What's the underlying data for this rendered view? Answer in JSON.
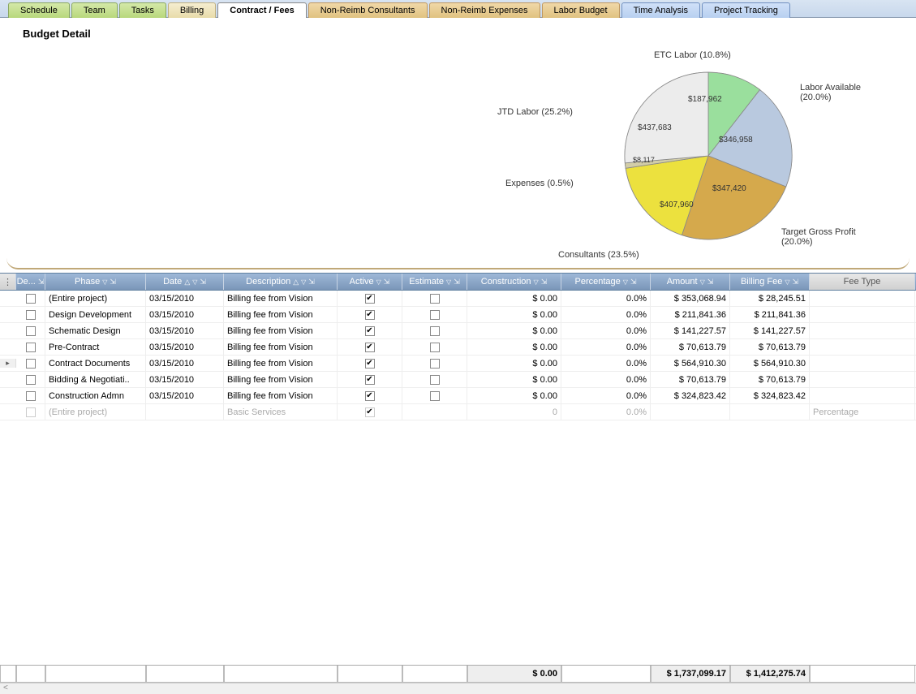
{
  "tabs": {
    "schedule": "Schedule",
    "team": "Team",
    "tasks": "Tasks",
    "billing": "Billing",
    "contract": "Contract / Fees",
    "nrc": "Non-Reimb Consultants",
    "nre": "Non-Reimb Expenses",
    "labor": "Labor Budget",
    "time": "Time Analysis",
    "ptrack": "Project Tracking"
  },
  "panel": {
    "title": "Budget Detail"
  },
  "chart_data": {
    "type": "pie",
    "title": "Budget Detail",
    "series": [
      {
        "name": "ETC Labor",
        "pct": 10.8,
        "value": 187962,
        "label": "$187,962",
        "color": "#9adf9d"
      },
      {
        "name": "Labor Available",
        "pct": 20.0,
        "value": 346958,
        "label": "$346,958",
        "color": "#b9c9df"
      },
      {
        "name": "Target Gross Profit",
        "pct": 20.0,
        "value": 347420,
        "label": "$347,420",
        "color": "#d5a94c"
      },
      {
        "name": "Consultants",
        "pct": 23.5,
        "value": 407960,
        "label": "$407,960",
        "color": "#ece13e"
      },
      {
        "name": "Expenses",
        "pct": 0.5,
        "value": 8117,
        "label": "$8,117",
        "color": "#d2cda8"
      },
      {
        "name": "JTD Labor",
        "pct": 25.2,
        "value": 437683,
        "label": "$437,683",
        "color": "#ececec"
      }
    ],
    "outer_labels": {
      "etc": "ETC Labor (10.8%)",
      "lav": "Labor Available (20.0%)",
      "tgp": "Target Gross Profit (20.0%)",
      "cons": "Consultants (23.5%)",
      "exp": "Expenses (0.5%)",
      "jtd": "JTD Labor (25.2%)"
    }
  },
  "grid": {
    "headers": {
      "de": "De...",
      "phase": "Phase",
      "date": "Date",
      "desc": "Description",
      "active": "Active",
      "est": "Estimate",
      "constr": "Construction",
      "pct": "Percentage",
      "amt": "Amount",
      "bfee": "Billing Fee",
      "ftype": "Fee Type"
    },
    "rows": [
      {
        "sel": "",
        "phase": "(Entire project)",
        "date": "03/15/2010",
        "desc": "Billing fee from Vision",
        "active": true,
        "est": false,
        "constr": "$ 0.00",
        "pct": "0.0%",
        "amt": "$ 353,068.94",
        "bfee": "$ 28,245.51",
        "ftype": ""
      },
      {
        "sel": "",
        "phase": "Design Development",
        "date": "03/15/2010",
        "desc": "Billing fee from Vision",
        "active": true,
        "est": false,
        "constr": "$ 0.00",
        "pct": "0.0%",
        "amt": "$ 211,841.36",
        "bfee": "$ 211,841.36",
        "ftype": ""
      },
      {
        "sel": "",
        "phase": "Schematic Design",
        "date": "03/15/2010",
        "desc": "Billing fee from Vision",
        "active": true,
        "est": false,
        "constr": "$ 0.00",
        "pct": "0.0%",
        "amt": "$ 141,227.57",
        "bfee": "$ 141,227.57",
        "ftype": ""
      },
      {
        "sel": "",
        "phase": "Pre-Contract",
        "date": "03/15/2010",
        "desc": "Billing fee from Vision",
        "active": true,
        "est": false,
        "constr": "$ 0.00",
        "pct": "0.0%",
        "amt": "$ 70,613.79",
        "bfee": "$ 70,613.79",
        "ftype": ""
      },
      {
        "sel": "▸",
        "phase": "Contract Documents",
        "date": "03/15/2010",
        "desc": "Billing fee from Vision",
        "active": true,
        "est": false,
        "constr": "$ 0.00",
        "pct": "0.0%",
        "amt": "$ 564,910.30",
        "bfee": "$ 564,910.30",
        "ftype": ""
      },
      {
        "sel": "",
        "phase": "Bidding & Negotiati..",
        "date": "03/15/2010",
        "desc": "Billing fee from Vision",
        "active": true,
        "est": false,
        "constr": "$ 0.00",
        "pct": "0.0%",
        "amt": "$ 70,613.79",
        "bfee": "$ 70,613.79",
        "ftype": ""
      },
      {
        "sel": "",
        "phase": "Construction Admn",
        "date": "03/15/2010",
        "desc": "Billing fee from Vision",
        "active": true,
        "est": false,
        "constr": "$ 0.00",
        "pct": "0.0%",
        "amt": "$ 324,823.42",
        "bfee": "$ 324,823.42",
        "ftype": ""
      }
    ],
    "ghost": {
      "phase": "(Entire project)",
      "desc": "Basic Services",
      "active": true,
      "constr": "0",
      "pct": "0.0%",
      "ftype": "Percentage"
    },
    "totals": {
      "constr": "$ 0.00",
      "amt": "$ 1,737,099.17",
      "bfee": "$ 1,412,275.74"
    }
  }
}
